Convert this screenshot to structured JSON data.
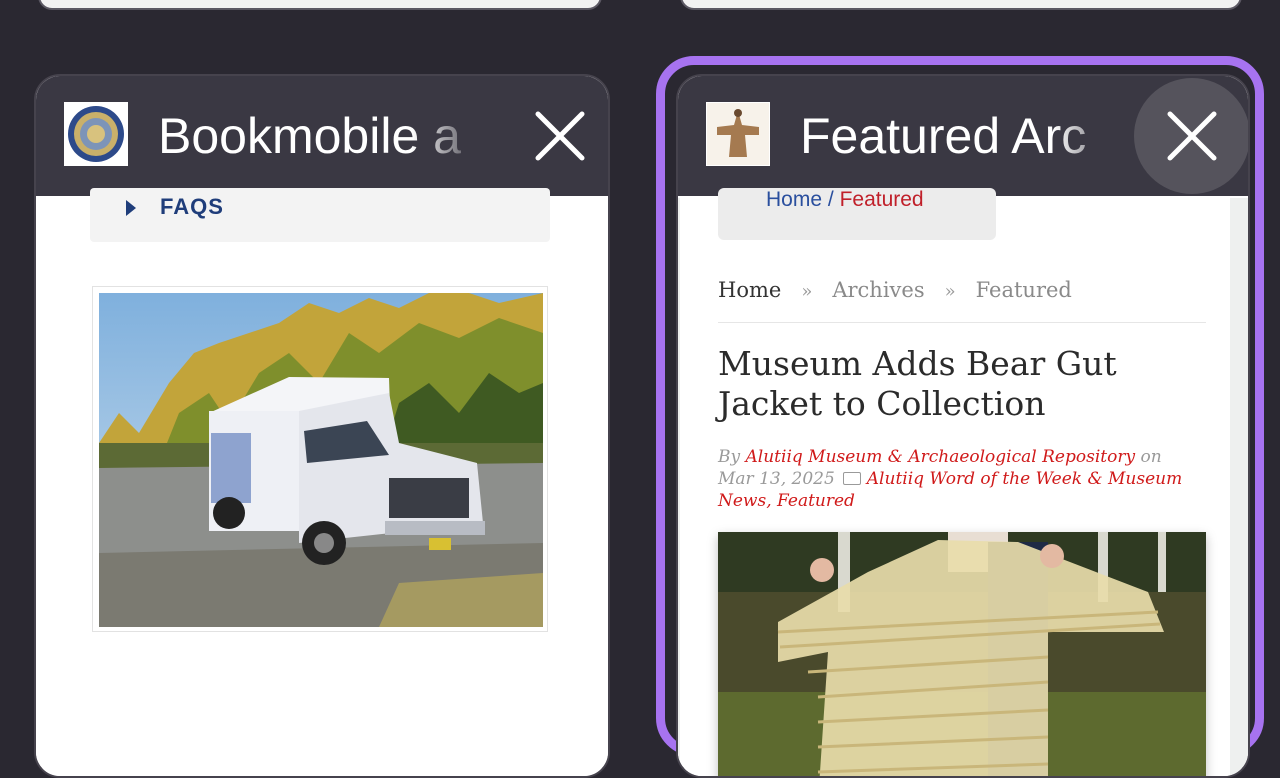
{
  "tabs": [
    {
      "title": "Bookmobile a",
      "favicon": "seal-logo-icon",
      "selected": false,
      "page": {
        "faq_label": "FAQS",
        "image": "bookmobile-van-photo"
      }
    },
    {
      "title": "Featured Arc",
      "favicon": "bear-gut-jacket-icon",
      "selected": true,
      "page": {
        "pill_home": "Home",
        "pill_sep": "/",
        "pill_current": "Featured",
        "crumb_home": "Home",
        "crumb_sep": "»",
        "crumb_archives": "Archives",
        "crumb_featured": "Featured",
        "article_title": "Museum Adds Bear Gut Jacket to Collection",
        "by": "By",
        "author": "Alutiiq Museum & Archaeological Repository",
        "on": "on",
        "date": "Mar 13, 2025",
        "categories": "Alutiiq Word of the Week & Museum News, Featured",
        "image": "bear-gut-jacket-photo"
      }
    }
  ],
  "colors": {
    "background": "#2a2831",
    "tab_header": "#3a3843",
    "selected_ring": "#a773f0",
    "link_red": "#d01a1a",
    "faq_blue": "#1f3d7a"
  }
}
